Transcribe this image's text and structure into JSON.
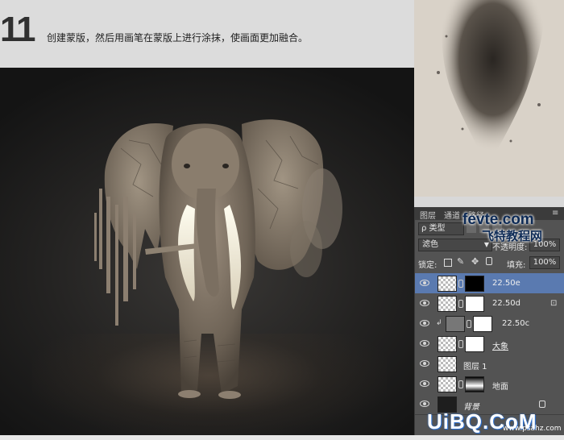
{
  "header": {
    "step_number": "11",
    "instruction": "创建蒙版，然后用画笔在蒙版上进行涂抹，使画面更加融合。"
  },
  "panel": {
    "tabs": [
      "图层",
      "通道",
      "路径"
    ],
    "filter_label": "ρ 类型",
    "blend_mode": "滤色",
    "opacity_label": "不透明度:",
    "opacity_value": "100%",
    "lock_label": "锁定:",
    "fill_label": "填充:",
    "fill_value": "100%",
    "layers": [
      {
        "name": "22.50e",
        "selected": true
      },
      {
        "name": "22.50d"
      },
      {
        "name": "22.50c"
      },
      {
        "name": "大象"
      },
      {
        "name": "图层 1"
      },
      {
        "name": "地面"
      },
      {
        "name": "背景"
      }
    ]
  },
  "watermarks": {
    "fevte": "fevte.com",
    "fevte_cn": "飞特教程网",
    "uibq": "UiBQ.CoM",
    "uibq_small": "www.psahz.com"
  },
  "colors": {
    "selected_layer": "#5a7ab0",
    "panel_bg": "#535353",
    "canvas_bg": "#242322"
  }
}
